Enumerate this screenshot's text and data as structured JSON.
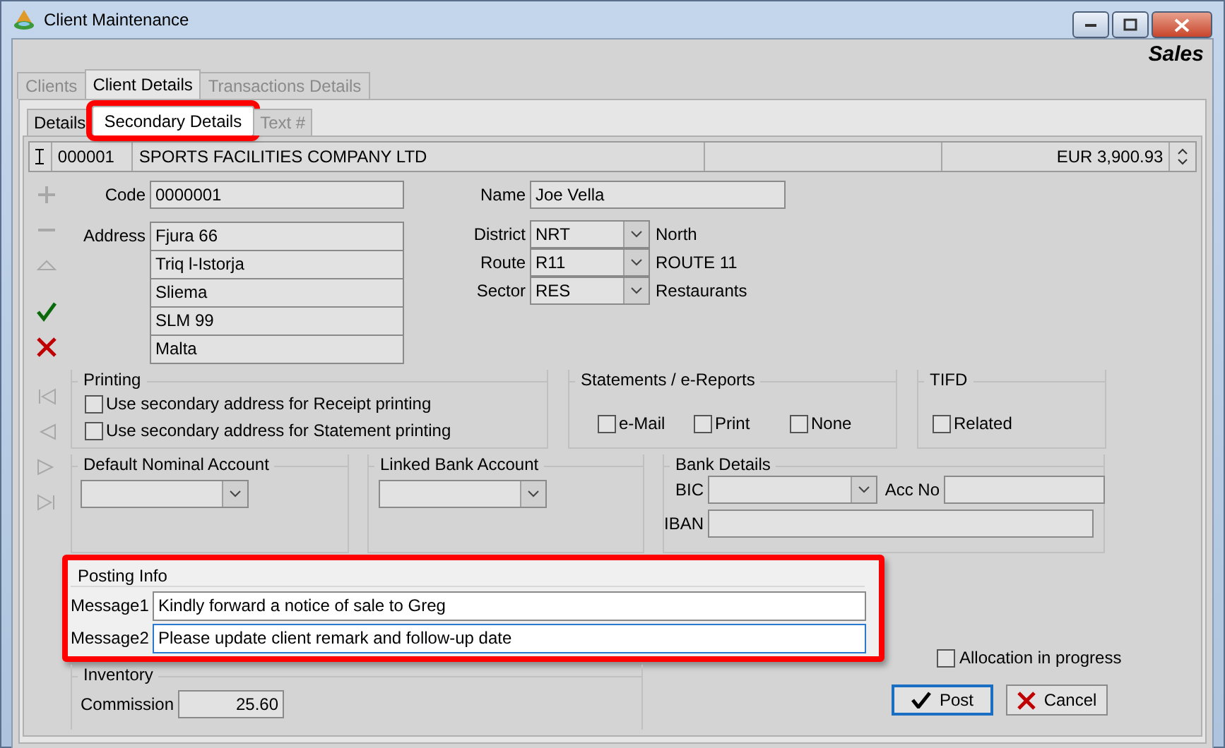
{
  "window": {
    "title": "Client Maintenance"
  },
  "module_label": "Sales",
  "tabs": [
    {
      "label": "Clients",
      "selected": false,
      "disabled": true
    },
    {
      "label": "Client Details",
      "selected": true,
      "disabled": false
    },
    {
      "label": "Transactions Details",
      "selected": false,
      "disabled": true
    }
  ],
  "subtabs": [
    {
      "label": "Details",
      "selected": false,
      "disabled": false,
      "highlighted": false
    },
    {
      "label": "Secondary Details",
      "selected": true,
      "disabled": false,
      "highlighted": true
    },
    {
      "label": "Text #",
      "selected": false,
      "disabled": true,
      "highlighted": false
    }
  ],
  "record": {
    "code": "000001",
    "name": "SPORTS FACILITIES COMPANY LTD",
    "balance": "EUR 3,900.93"
  },
  "toolbar": [
    {
      "kind": "add",
      "disabled": true
    },
    {
      "kind": "remove",
      "disabled": true
    },
    {
      "kind": "up",
      "disabled": true
    },
    {
      "kind": "confirm",
      "disabled": false
    },
    {
      "kind": "cancel",
      "disabled": false
    },
    {
      "kind": "first",
      "disabled": true
    },
    {
      "kind": "prev",
      "disabled": true
    },
    {
      "kind": "next",
      "disabled": true
    },
    {
      "kind": "last",
      "disabled": true
    }
  ],
  "code": {
    "label": "Code",
    "value": "0000001"
  },
  "address": {
    "label": "Address",
    "lines": [
      "Fjura 66",
      "Triq l-Istorja",
      "Sliema",
      "SLM 99",
      "Malta"
    ]
  },
  "name": {
    "label": "Name",
    "value": "Joe Vella"
  },
  "lookups": [
    {
      "label": "District",
      "value": "NRT",
      "description": "North"
    },
    {
      "label": "Route",
      "value": "R11",
      "description": "ROUTE 11"
    },
    {
      "label": "Sector",
      "value": "RES",
      "description": "Restaurants"
    }
  ],
  "printing": {
    "title": "Printing",
    "options": [
      {
        "label": "Use secondary address for Receipt printing",
        "checked": false
      },
      {
        "label": "Use secondary address for Statement printing",
        "checked": false
      }
    ]
  },
  "statements": {
    "title": "Statements / e-Reports",
    "options": [
      {
        "label": "e-Mail",
        "checked": false
      },
      {
        "label": "Print",
        "checked": false
      },
      {
        "label": "None",
        "checked": false
      }
    ]
  },
  "tifd": {
    "title": "TIFD",
    "options": [
      {
        "label": "Related",
        "checked": false
      }
    ]
  },
  "default_nominal_account": {
    "title": "Default Nominal Account"
  },
  "linked_bank_account": {
    "title": "Linked Bank Account"
  },
  "bank_details": {
    "title": "Bank Details",
    "bic_label": "BIC",
    "acc_no_label": "Acc No",
    "iban_label": "IBAN"
  },
  "posting_info": {
    "title": "Posting Info",
    "highlighted": true,
    "messages": [
      {
        "label": "Message1",
        "value": "Kindly forward a notice of sale to Greg",
        "focused": false
      },
      {
        "label": "Message2",
        "value": "Please update client remark and follow-up date",
        "focused": true
      }
    ]
  },
  "inventory": {
    "title": "Inventory",
    "commission_label": "Commission",
    "commission": "25.60"
  },
  "allocation": {
    "label": "Allocation in progress",
    "checked": false
  },
  "buttons": [
    {
      "kind": "post",
      "label": "Post",
      "default": true
    },
    {
      "kind": "cancel",
      "label": "Cancel",
      "default": false
    }
  ]
}
